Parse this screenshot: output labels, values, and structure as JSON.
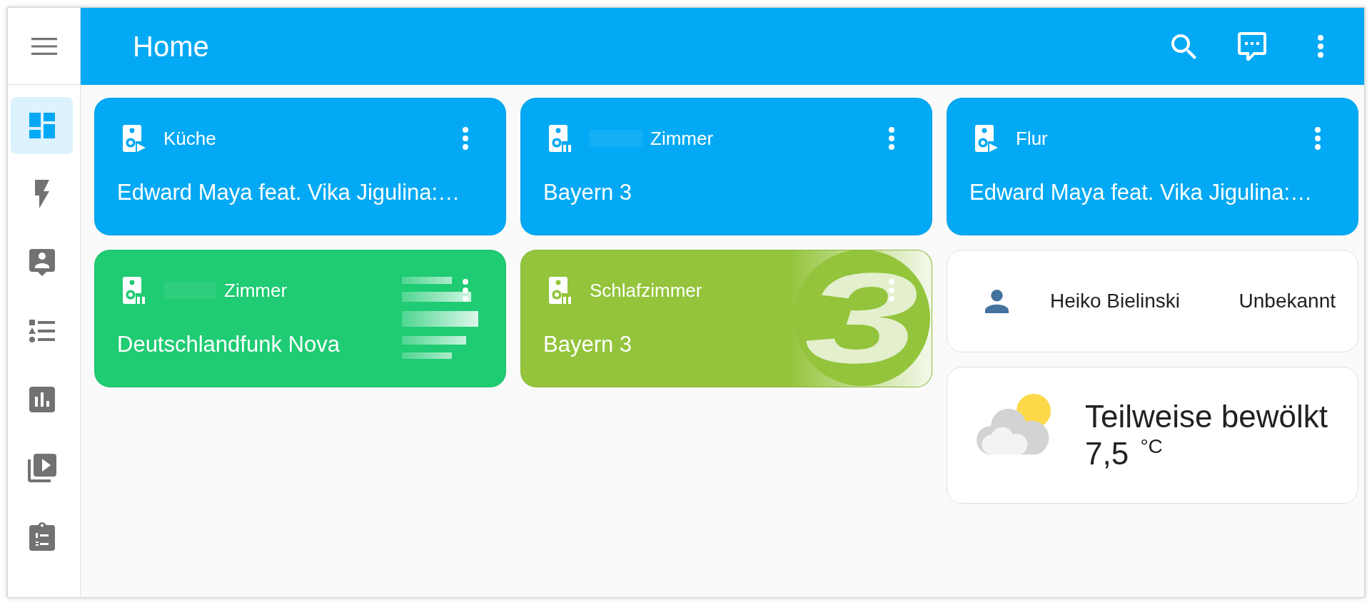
{
  "sidebar": {
    "items": [
      {
        "kind": "grid",
        "selected": true
      },
      {
        "kind": "bolt",
        "selected": false
      },
      {
        "kind": "contact",
        "selected": false
      },
      {
        "kind": "list",
        "selected": false
      },
      {
        "kind": "chart",
        "selected": false
      },
      {
        "kind": "player",
        "selected": false
      },
      {
        "kind": "clipboard",
        "selected": false
      }
    ]
  },
  "header": {
    "title": "Home"
  },
  "columns": [
    {
      "cards": [
        {
          "kind": "media",
          "name": "Küche",
          "redacted": false,
          "playing": true,
          "title": "Edward Maya feat. Vika Jigulina:…",
          "color": "#03a9f4"
        },
        {
          "kind": "media",
          "name": "Zimmer",
          "redacted": true,
          "playing": false,
          "title": "Deutschlandfunk Nova",
          "color": "#1fcb73",
          "artwork": {
            "kind": "bars"
          }
        }
      ]
    },
    {
      "cards": [
        {
          "kind": "media",
          "name": "Zimmer",
          "redacted": true,
          "playing": false,
          "title": "Bayern 3",
          "color": "#03a9f4"
        },
        {
          "kind": "media",
          "name": "Schlafzimmer",
          "redacted": false,
          "playing": false,
          "title": "Bayern 3",
          "color": "#93c43b",
          "artwork": {
            "kind": "badge",
            "text": "3"
          }
        }
      ]
    },
    {
      "cards": [
        {
          "kind": "media",
          "name": "Flur",
          "redacted": false,
          "playing": true,
          "title": "Edward Maya feat. Vika Jigulina:…",
          "color": "#03a9f4"
        },
        {
          "kind": "person",
          "name": "Heiko Bielinski",
          "state": "Unbekannt"
        },
        {
          "kind": "weather",
          "condition": "Teilweise bewölkt",
          "temperature": "7,5",
          "unit": "°C"
        }
      ]
    }
  ]
}
